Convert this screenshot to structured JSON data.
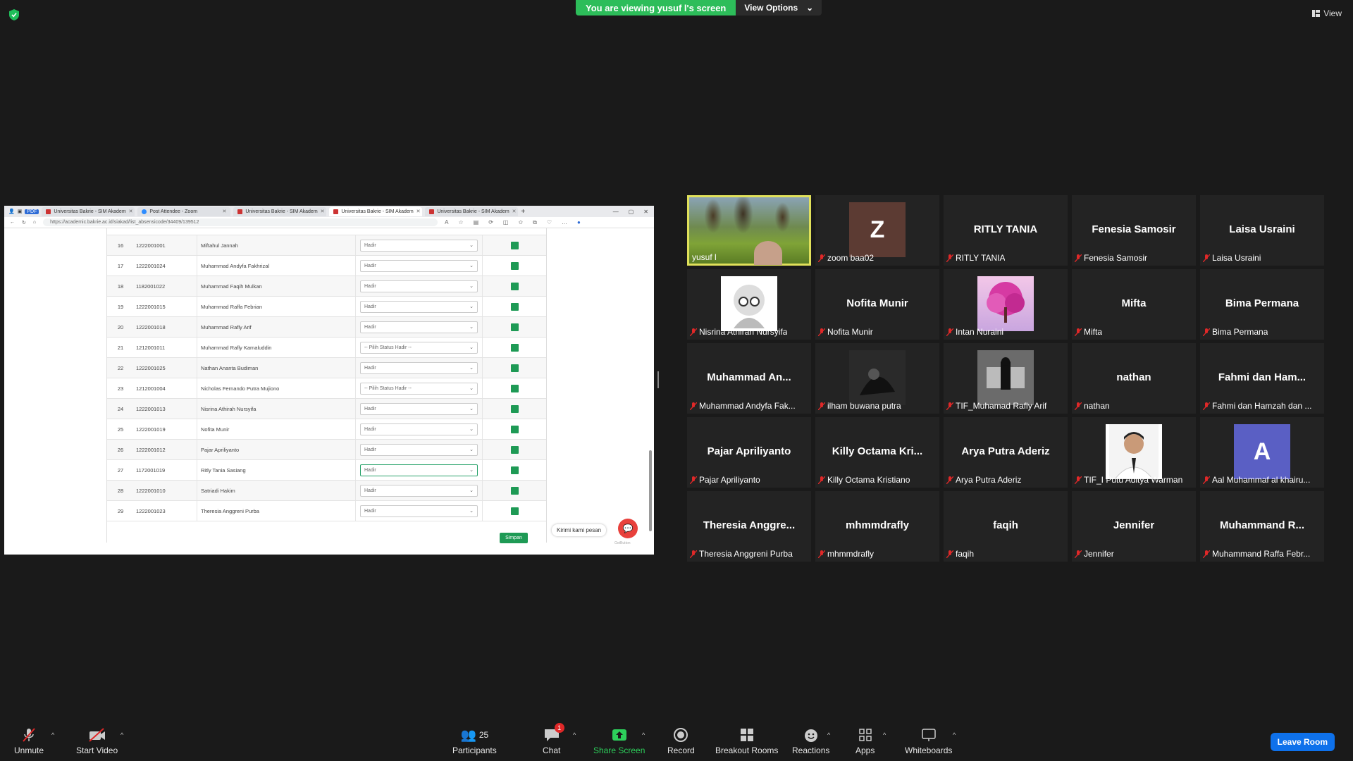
{
  "banner": {
    "message": "You are viewing yusuf l's screen",
    "options": "View Options"
  },
  "view_label": "View",
  "browser": {
    "tabs": [
      {
        "label": "Universitas Bakrie - SIM Akadem",
        "active": false,
        "icon": "university-favicon"
      },
      {
        "label": "Post Attendee - Zoom",
        "active": false,
        "icon": "zoom-favicon"
      },
      {
        "label": "Universitas Bakrie - SIM Akadem",
        "active": false,
        "icon": "university-favicon"
      },
      {
        "label": "Universitas Bakrie - SIM Akadem",
        "active": true,
        "icon": "university-favicon"
      },
      {
        "label": "Universitas Bakrie - SIM Akadem",
        "active": false,
        "icon": "university-favicon"
      }
    ],
    "url": "https://academic.bakrie.ac.id/siakad/list_absensicode/34409/139512"
  },
  "attendance": {
    "rows": [
      {
        "no": "16",
        "nim": "1222001001",
        "nama": "Miftahul Jannah",
        "status": "Hadir"
      },
      {
        "no": "17",
        "nim": "1222001024",
        "nama": "Muhammad Andyfa Fakhrizal",
        "status": "Hadir"
      },
      {
        "no": "18",
        "nim": "1182001022",
        "nama": "Muhammad Faqih Mulkan",
        "status": "Hadir"
      },
      {
        "no": "19",
        "nim": "1222001015",
        "nama": "Muhammad Raffa Febrian",
        "status": "Hadir"
      },
      {
        "no": "20",
        "nim": "1222001018",
        "nama": "Muhammad Rafly Arif",
        "status": "Hadir"
      },
      {
        "no": "21",
        "nim": "1212001011",
        "nama": "Muhammad Rafly Kamaluddin",
        "status": "-- Pilih Status Hadir --"
      },
      {
        "no": "22",
        "nim": "1222001025",
        "nama": "Nathan Ananta Budiman",
        "status": "Hadir"
      },
      {
        "no": "23",
        "nim": "1212001004",
        "nama": "Nicholas Fernando Putra Mujiono",
        "status": "-- Pilih Status Hadir --"
      },
      {
        "no": "24",
        "nim": "1222001013",
        "nama": "Nisrina Athirah Nursyifa",
        "status": "Hadir"
      },
      {
        "no": "25",
        "nim": "1222001019",
        "nama": "Nofita Munir",
        "status": "Hadir"
      },
      {
        "no": "26",
        "nim": "1222001012",
        "nama": "Pajar Apriliyanto",
        "status": "Hadir"
      },
      {
        "no": "27",
        "nim": "1172001019",
        "nama": "Ritly Tania Sasiang",
        "status": "Hadir"
      },
      {
        "no": "28",
        "nim": "1222001010",
        "nama": "Satriadi Hakim",
        "status": "Hadir"
      },
      {
        "no": "29",
        "nim": "1222001023",
        "nama": "Theresia Anggreni Purba",
        "status": "Hadir"
      }
    ],
    "save_label": "Simpan",
    "chat_prompt": "Kirimi kami pesan",
    "chat_brand": "GetButton"
  },
  "participants": [
    {
      "name": "yusuf l",
      "big": "",
      "type": "video"
    },
    {
      "name": "zoom baa02",
      "big": "",
      "type": "letter",
      "letter": "Z",
      "color": "#5c3b33"
    },
    {
      "name": "RITLY TANIA",
      "big": "RITLY TANIA",
      "type": "text"
    },
    {
      "name": "Fenesia Samosir",
      "big": "Fenesia Samosir",
      "type": "text"
    },
    {
      "name": "Laisa Usraini",
      "big": "Laisa Usraini",
      "type": "text"
    },
    {
      "name": "Nisrina Athirah Nursyifa",
      "big": "",
      "type": "memoji"
    },
    {
      "name": "Nofita Munir",
      "big": "Nofita Munir",
      "type": "text"
    },
    {
      "name": "Intan Nuraini",
      "big": "",
      "type": "tree"
    },
    {
      "name": "Mifta",
      "big": "Mifta",
      "type": "text"
    },
    {
      "name": "Bima Permana",
      "big": "Bima Permana",
      "type": "text"
    },
    {
      "name": "Muhammad Andyfa Fak...",
      "big": "Muhammad An...",
      "type": "text"
    },
    {
      "name": "ilham buwana putra",
      "big": "",
      "type": "dark"
    },
    {
      "name": "TIF_Muhamad Rafly Arif",
      "big": "",
      "type": "bench"
    },
    {
      "name": "nathan",
      "big": "nathan",
      "type": "text"
    },
    {
      "name": "Fahmi dan Hamzah dan ...",
      "big": "Fahmi dan Ham...",
      "type": "text"
    },
    {
      "name": "Pajar Apriliyanto",
      "big": "Pajar Apriliyanto",
      "type": "text"
    },
    {
      "name": "Killy Octama Kristiano",
      "big": "Killy Octama Kri...",
      "type": "text"
    },
    {
      "name": "Arya Putra Aderiz",
      "big": "Arya Putra Aderiz",
      "type": "text"
    },
    {
      "name": "TIF_I Putu Aditya Warman",
      "big": "",
      "type": "portrait"
    },
    {
      "name": "Aal Muhammaf al khairu...",
      "big": "",
      "type": "letter",
      "letter": "A",
      "color": "#5a5fc4"
    },
    {
      "name": "Theresia Anggreni Purba",
      "big": "Theresia Anggre...",
      "type": "text"
    },
    {
      "name": "mhmmdrafly",
      "big": "mhmmdrafly",
      "type": "text"
    },
    {
      "name": "faqih",
      "big": "faqih",
      "type": "text"
    },
    {
      "name": "Jennifer",
      "big": "Jennifer",
      "type": "text"
    },
    {
      "name": "Muhammand Raffa Febr...",
      "big": "Muhammand R...",
      "type": "text"
    }
  ],
  "toolbar": {
    "unmute": "Unmute",
    "start_video": "Start Video",
    "participants": "Participants",
    "participants_count": "25",
    "chat": "Chat",
    "chat_badge": "1",
    "share": "Share Screen",
    "record": "Record",
    "breakout": "Breakout Rooms",
    "reactions": "Reactions",
    "apps": "Apps",
    "whiteboards": "Whiteboards",
    "leave": "Leave Room"
  }
}
